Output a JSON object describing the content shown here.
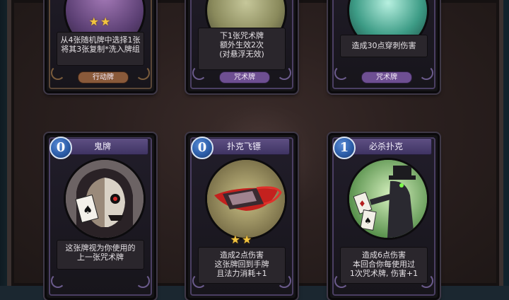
{
  "colors": {
    "spell_badge": "#6e4f92",
    "action_badge": "#8a5a3a",
    "cost_orb": "#2c5ea9",
    "star": "#f2c440"
  },
  "top_cards": [
    {
      "stars": "★★",
      "desc": [
        "从4张随机牌中选择1张",
        "将其3张复制*洗入牌组"
      ],
      "type": "行动牌",
      "category": "action"
    },
    {
      "stars": "",
      "desc": [
        "下1张咒术牌",
        "额外生效2次",
        "(对悬浮无效)"
      ],
      "type": "咒术牌",
      "category": "spell"
    },
    {
      "stars": "",
      "desc": [
        "造成30点穿刺伤害"
      ],
      "type": "咒术牌",
      "category": "spell"
    }
  ],
  "bottom_cards": [
    {
      "cost": "0",
      "name": "鬼牌",
      "art": "joker-skull-art",
      "stars": "",
      "desc": [
        "这张牌视为你使用的",
        "上一张咒术牌"
      ]
    },
    {
      "cost": "0",
      "name": "扑克飞镖",
      "art": "card-dart-art",
      "stars": "★★",
      "desc": [
        "造成2点伤害",
        "这张牌回到手牌",
        "且法力消耗+1"
      ]
    },
    {
      "cost": "1",
      "name": "必杀扑克",
      "art": "gambler-art",
      "stars": "",
      "desc": [
        "造成6点伤害",
        "本回合你每使用过",
        "1次咒术牌, 伤害+1"
      ]
    }
  ]
}
